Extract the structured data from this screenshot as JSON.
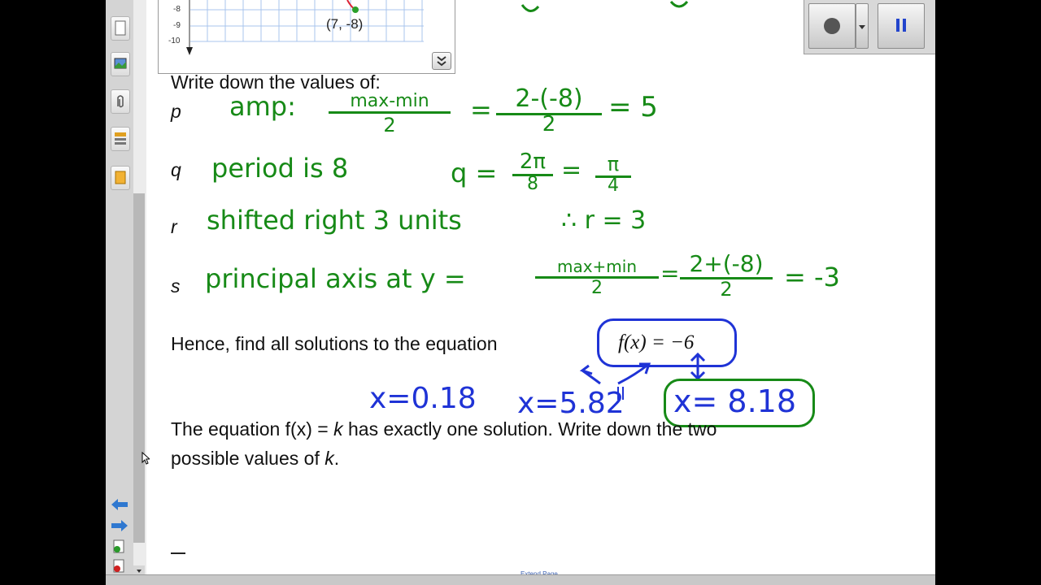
{
  "graph": {
    "y_ticks": [
      "-8",
      "-9",
      "-10"
    ],
    "point_label": "(7, -8)"
  },
  "questions": {
    "q1": "Write down the values of:",
    "var_p": "p",
    "var_q": "q",
    "var_r": "r",
    "var_s": "s",
    "q2": "Hence, find all solutions to the equation",
    "q2_equation": "f(x) = −6",
    "q3_line1_pre": "The equation f(x) = ",
    "q3_k": "k",
    "q3_line1_post": " has exactly one solution.  Write down the two",
    "q3_line2_pre": "possible values of ",
    "q3_line2_k": "k",
    "q3_line2_post": "."
  },
  "handwriting": {
    "p_amp_label": "amp:",
    "p_numerator": "max-min",
    "p_denominator": "2",
    "p_eq1": "=",
    "p_numerator2": "2-(-8)",
    "p_denominator2": "2",
    "p_result": "= 5",
    "q_text": "period is 8",
    "q_var": "q =",
    "q_frac_num": "2π",
    "q_frac_den": "8",
    "q_eq": "=",
    "q_frac2_num": "π",
    "q_frac2_den": "4",
    "r_text": "shifted right 3 units",
    "r_therefore": "∴ r = 3",
    "s_text": "principal axis at y =",
    "s_frac_num": "max+min",
    "s_frac_den": "2",
    "s_eq": "=",
    "s_frac2_num": "2+(-8)",
    "s_frac2_den": "2",
    "s_result": "= -3",
    "sol1": "x=0.18",
    "sol2": "x=5.82",
    "sol3": "x= 8.18"
  },
  "bottom_bar": {
    "extend_page": "Extend Page"
  },
  "colors": {
    "ink_green": "#178a17",
    "ink_blue": "#1f33d6",
    "app_bg": "#ffffff",
    "side_bg": "#d4d4d4"
  },
  "icons": [
    "page-sorter-icon",
    "gallery-icon",
    "attachments-icon",
    "properties-icon",
    "addons-icon",
    "back-arrow-icon",
    "forward-arrow-icon",
    "add-page-icon",
    "delete-page-icon",
    "record-icon",
    "pause-icon",
    "expand-icon"
  ]
}
